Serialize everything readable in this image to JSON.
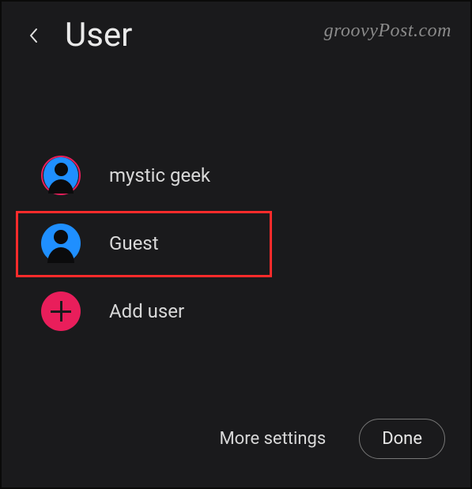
{
  "header": {
    "title": "User"
  },
  "watermark": "groovyPost.com",
  "users": [
    {
      "label": "mystic geek"
    },
    {
      "label": "Guest"
    },
    {
      "label": "Add user"
    }
  ],
  "footer": {
    "more_settings": "More settings",
    "done": "Done"
  }
}
